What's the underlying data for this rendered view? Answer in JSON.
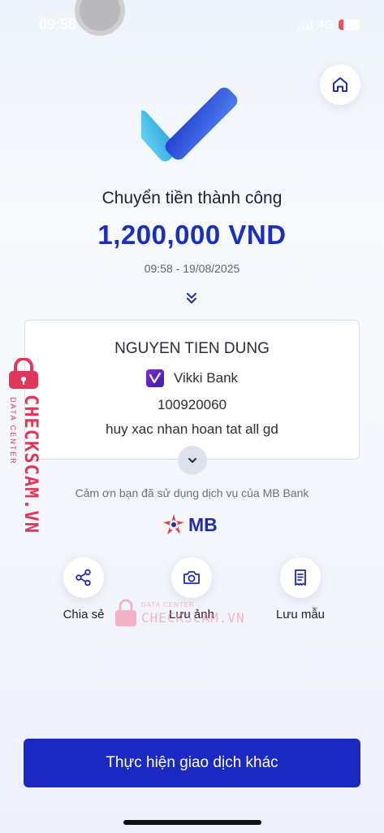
{
  "status_bar": {
    "time": "09:58",
    "network": "4G"
  },
  "header": {
    "home_icon": "home-icon"
  },
  "result": {
    "title": "Chuyển tiền thành công",
    "amount": "1,200,000 VND",
    "datetime": "09:58 - 19/08/2025"
  },
  "recipient": {
    "name": "NGUYEN TIEN DUNG",
    "bank_name": "Vikki Bank",
    "account_number": "100920060",
    "note": "huy xac nhan hoan tat all gd"
  },
  "footer_info": {
    "thanks": "Cảm ơn bạn đã sử dụng dịch vụ của MB Bank",
    "brand": "MB"
  },
  "actions": [
    {
      "label": "Chia sẻ",
      "icon": "share-icon"
    },
    {
      "label": "Lưu ảnh",
      "icon": "camera-icon"
    },
    {
      "label": "Lưu mẫu",
      "icon": "receipt-icon"
    }
  ],
  "primary_button": {
    "label": "Thực hiện giao dịch khác"
  },
  "watermark": {
    "text": "CHECKSCAM.VN",
    "subtext": "DATA CENTER"
  },
  "colors": {
    "accent": "#1c28c2",
    "amount": "#1b2fbf",
    "watermark": "#e0375a"
  }
}
